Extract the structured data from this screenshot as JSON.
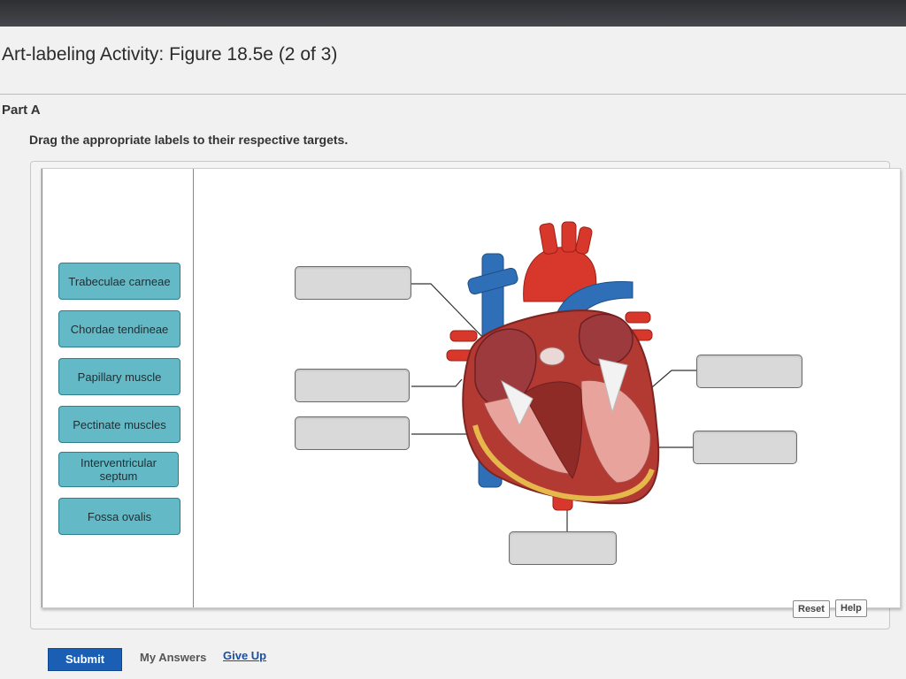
{
  "activity": {
    "title": "Art-labeling Activity: Figure 18.5e (2 of 3)",
    "part": "Part A",
    "instruction": "Drag the appropriate labels to their respective targets."
  },
  "labels": [
    "Trabeculae carneae",
    "Chordae tendineae",
    "Papillary muscle",
    "Pectinate muscles",
    "Interventricular septum",
    "Fossa ovalis"
  ],
  "targets": [
    {
      "name": "target-box-upper-left",
      "value": ""
    },
    {
      "name": "target-box-middle-left",
      "value": ""
    },
    {
      "name": "target-box-lower-left",
      "value": ""
    },
    {
      "name": "target-box-upper-right",
      "value": ""
    },
    {
      "name": "target-box-lower-right",
      "value": ""
    },
    {
      "name": "target-box-bottom",
      "value": ""
    }
  ],
  "buttons": {
    "reset": "Reset",
    "help": "Help",
    "submit": "Submit",
    "my_answers": "My Answers",
    "give_up": "Give Up"
  },
  "colors": {
    "label_fill": "#64b9c6",
    "submit_fill": "#1a5fb4",
    "link": "#1a4fa0"
  }
}
